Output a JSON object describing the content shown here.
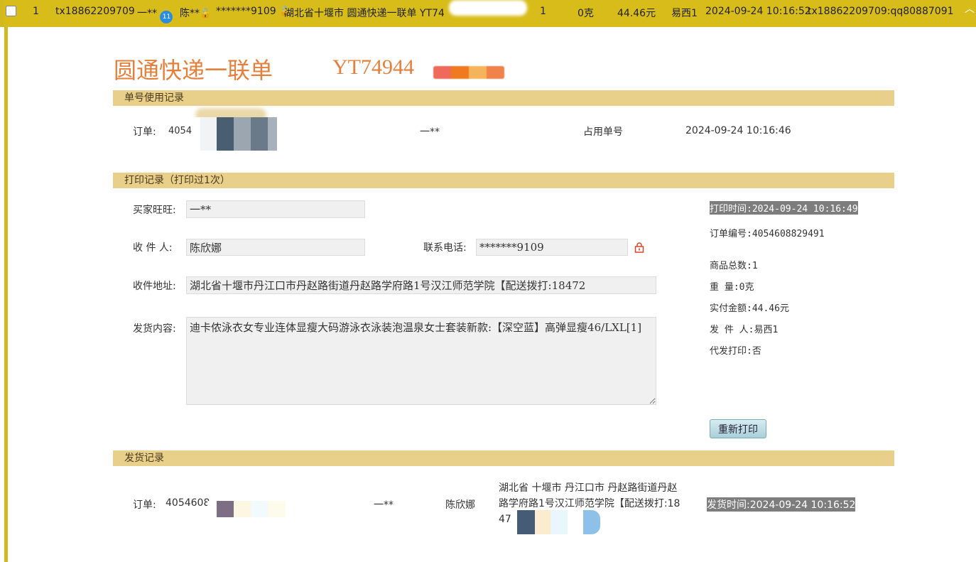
{
  "row": {
    "index": "1",
    "account": "tx18862209709",
    "buyer": "一**",
    "badge": "11",
    "receiver": "陈**",
    "phone": "*******9109",
    "summary": "湖北省十堰市 圆通快递一联单 YT74",
    "qty": "1",
    "weight": "0克",
    "amount": "44.46元",
    "sender": "易西1",
    "time": "2024-09-24 10:16:52",
    "ref": "tx18862209709:qq80887091",
    "colors": {
      "bar": "#d8bd1a",
      "badge": "#2a8de0",
      "lock": "#e0442c"
    }
  },
  "header": {
    "title": "圆通快递一联单",
    "tracking_prefix": "YT74944"
  },
  "usage": {
    "section_title": "单号使用记录",
    "order_label": "订单:",
    "order_value": "4054",
    "buyer": "一**",
    "status": "占用单号",
    "time": "2024-09-24 10:16:46"
  },
  "print": {
    "section_title": "打印记录（打印过1次）",
    "buyer_label": "买家旺旺:",
    "buyer_value": "一**",
    "receiver_label": "收 件 人:",
    "receiver_value": "陈欣娜",
    "phone_label": "联系电话:",
    "phone_value": "*******9109",
    "address_label": "收件地址:",
    "address_value": "湖北省十堰市丹江口市丹赵路街道丹赵路学府路1号汉江师范学院【配送拨打:18472",
    "content_label": "发货内容:",
    "content_value": "迪卡侬泳衣女专业连体显瘦大码游泳衣泳装泡温泉女士套装新款:【深空蓝】高弹显瘦46/LXL[1]",
    "print_time": "打印时间:2024-09-24 10:16:49",
    "order_no": "订单编号:4054608829491",
    "total_items": "商品总数:1",
    "weight": "重      量:0克",
    "paid": "实付金额:44.46元",
    "sender": "发 件 人:易西1",
    "proxy": "代发打印:否",
    "reprint_button": "重新打印"
  },
  "shipping": {
    "section_title": "发货记录",
    "order_label": "订单:",
    "order_value": "4054608",
    "buyer": "一**",
    "receiver": "陈欣娜",
    "address_line1": "湖北省 十堰市 丹江口市 丹赵路街道丹赵",
    "address_line2": "路学府路1号汉江师范学院【配送拨打:18",
    "address_line3": "472",
    "ship_time": "发货时间:2024-09-24 10:16:52"
  },
  "icons": [
    "checkbox-icon",
    "lock-icon",
    "resize-handle-icon",
    "chevron-up-icon"
  ]
}
